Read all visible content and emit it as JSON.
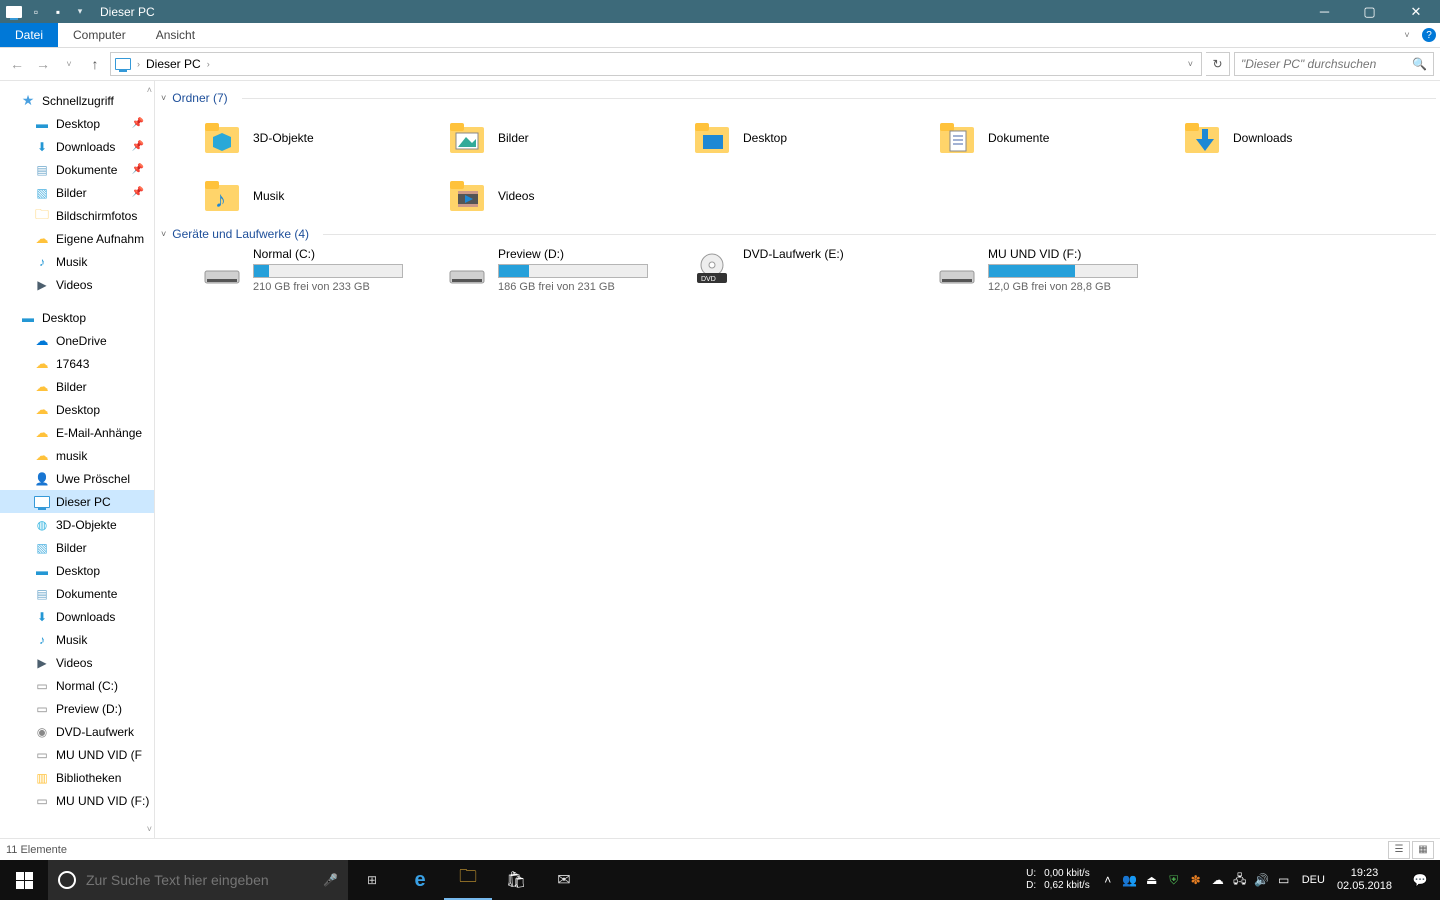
{
  "title": "Dieser PC",
  "ribbon": {
    "file": "Datei",
    "computer": "Computer",
    "view": "Ansicht"
  },
  "address": {
    "location": "Dieser PC",
    "search_placeholder": "\"Dieser PC\" durchsuchen"
  },
  "nav": {
    "quick": "Schnellzugriff",
    "quick_items": [
      "Desktop",
      "Downloads",
      "Dokumente",
      "Bilder",
      "Bildschirmfotos",
      "Eigene Aufnahm",
      "Musik",
      "Videos"
    ],
    "desktop": "Desktop",
    "desktop_items": [
      "OneDrive",
      "17643",
      "Bilder",
      "Desktop",
      "E-Mail-Anhänge",
      "musik",
      "Uwe Pröschel",
      "Dieser PC"
    ],
    "thispc_items": [
      "3D-Objekte",
      "Bilder",
      "Desktop",
      "Dokumente",
      "Downloads",
      "Musik",
      "Videos",
      "Normal (C:)",
      "Preview (D:)",
      "DVD-Laufwerk",
      "MU UND VID (F",
      "Bibliotheken",
      "MU UND VID (F:)"
    ]
  },
  "groups": {
    "folders_label": "Ordner (7)",
    "folders": [
      "3D-Objekte",
      "Bilder",
      "Desktop",
      "Dokumente",
      "Downloads",
      "Musik",
      "Videos"
    ],
    "drives_label": "Geräte und Laufwerke (4)",
    "drives": [
      {
        "name": "Normal (C:)",
        "free": "210 GB frei von 233 GB",
        "pct": 10
      },
      {
        "name": "Preview (D:)",
        "free": "186 GB frei von 231 GB",
        "pct": 20
      },
      {
        "name": "DVD-Laufwerk (E:)",
        "free": "",
        "pct": null
      },
      {
        "name": "MU UND VID (F:)",
        "free": "12,0 GB frei von 28,8 GB",
        "pct": 58
      }
    ]
  },
  "status": {
    "count": "11 Elemente"
  },
  "taskbar": {
    "search_placeholder": "Zur Suche Text hier eingeben",
    "net_u_label": "U:",
    "net_u_val": "0,00 kbit/s",
    "net_d_label": "D:",
    "net_d_val": "0,62 kbit/s",
    "lang": "DEU",
    "time": "19:23",
    "date": "02.05.2018"
  }
}
